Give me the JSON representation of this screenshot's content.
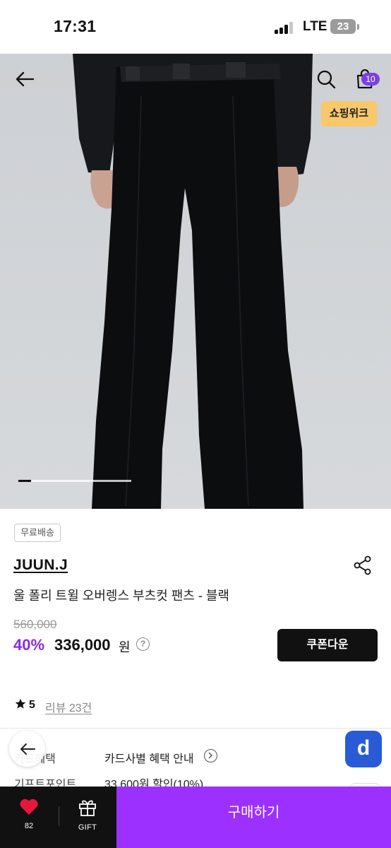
{
  "status_bar": {
    "time": "17:31",
    "network": "LTE",
    "battery": "23"
  },
  "header": {
    "cart_count": "10",
    "promo_tag": "쇼핑위크"
  },
  "carousel": {
    "current": 1
  },
  "product": {
    "shipping_badge": "무료배송",
    "brand": "JUUN.J",
    "name": "울 폴리 트윌 오버렝스 부츠컷 팬츠 - 블랙",
    "original_price": "560,000",
    "discount": "40%",
    "sale_price": "336,000",
    "currency": "원",
    "help_symbol": "?",
    "coupon_button": "쿠폰다운",
    "rating": "5",
    "review_link": "리뷰 23건"
  },
  "benefits": {
    "card_label": "카드혜택",
    "card_value": "카드사별 혜택 안내",
    "gift_label": "기프트포인트",
    "gift_value": "33,600원 할인(10%)"
  },
  "float": {
    "d_label": "d"
  },
  "bottom_bar": {
    "like_count": "82",
    "gift_label": "GIFT",
    "buy_label": "구매하기"
  },
  "colors": {
    "accent": "#9b30ff",
    "discount": "#8a2be2",
    "promo": "#f8c86b",
    "badge": "#7b3fe4"
  }
}
